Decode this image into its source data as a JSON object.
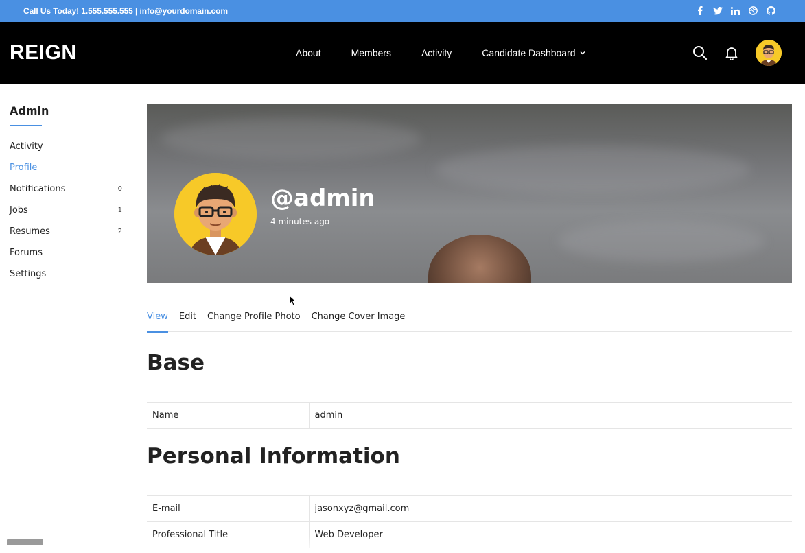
{
  "topbar": {
    "contact": "Call Us Today! 1.555.555.555 | info@yourdomain.com",
    "social_icons": [
      "facebook-icon",
      "twitter-icon",
      "linkedin-icon",
      "dribbble-icon",
      "github-icon"
    ]
  },
  "header": {
    "logo": "REIGN",
    "nav": [
      "About",
      "Members",
      "Activity",
      "Candidate Dashboard"
    ]
  },
  "sidebar": {
    "title": "Admin",
    "items": [
      {
        "label": "Activity",
        "count": ""
      },
      {
        "label": "Profile",
        "count": "",
        "active": true
      },
      {
        "label": "Notifications",
        "count": "0"
      },
      {
        "label": "Jobs",
        "count": "1"
      },
      {
        "label": "Resumes",
        "count": "2"
      },
      {
        "label": "Forums",
        "count": ""
      },
      {
        "label": "Settings",
        "count": ""
      }
    ]
  },
  "profile": {
    "username": "@admin",
    "last_active": "4 minutes ago"
  },
  "tabs": [
    "View",
    "Edit",
    "Change Profile Photo",
    "Change Cover Image"
  ],
  "sections": {
    "base": {
      "title": "Base",
      "rows": [
        {
          "key": "Name",
          "value": "admin"
        }
      ]
    },
    "personal": {
      "title": "Personal Information",
      "rows": [
        {
          "key": "E-mail",
          "value": "jasonxyz@gmail.com"
        },
        {
          "key": "Professional Title",
          "value": "Web Developer"
        }
      ]
    }
  },
  "colors": {
    "accent": "#4a90e2",
    "header_bg": "#000000",
    "avatar_bg": "#f7c928"
  }
}
